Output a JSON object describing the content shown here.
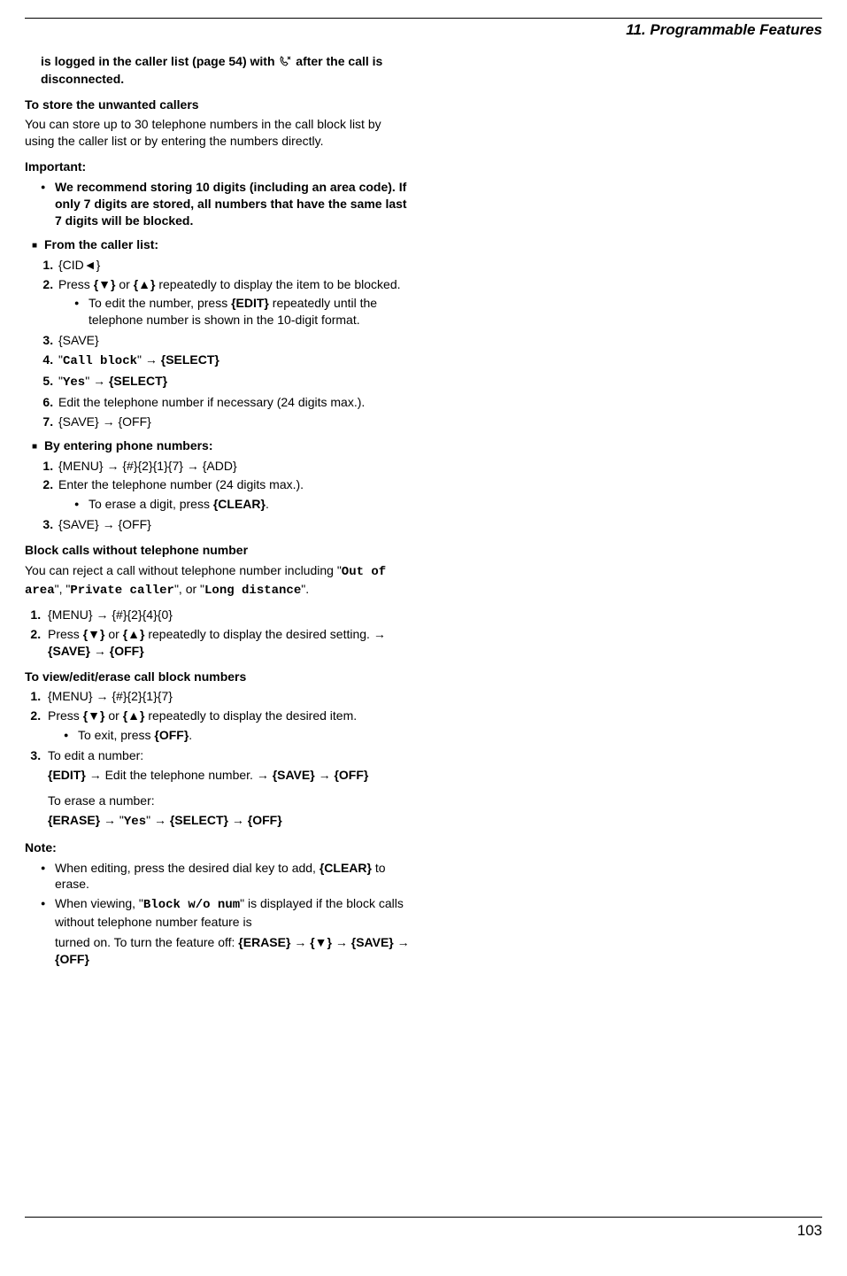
{
  "chapter": "11. Programmable Features",
  "col1": {
    "intro_logged": "is logged in the caller list (page 54) with ",
    "intro_after": " after the call is disconnected.",
    "store_head": "To store the unwanted callers",
    "store_body": "You can store up to 30 telephone numbers in the call block list by using the caller list or by entering the numbers directly.",
    "important_label": "Important:",
    "important_bullet": "We recommend storing 10 digits (including an area code). If only 7 digits are stored, all numbers that have the same last 7 digits will be blocked.",
    "from_caller_list": "From the caller list:",
    "fc1": "{CID◄}",
    "fc2a": "Press ",
    "fc2b": " or ",
    "fc2c": " repeatedly to display the item to be blocked.",
    "fc2_sub": "To edit the number, press {EDIT} repeatedly until the telephone number is shown in the 10-digit format.",
    "fc3": "{SAVE}",
    "fc4a": "\"",
    "fc4_mono": "Call block",
    "fc4b": "\" → {SELECT}",
    "fc5a": "\"",
    "fc5_mono": "Yes",
    "fc5b": "\" → {SELECT}",
    "fc6": "Edit the telephone number if necessary (24 digits max.).",
    "fc7": "{SAVE} → {OFF}",
    "by_entering": "By entering phone numbers:",
    "be1": "{MENU} → {#}{2}{1}{7} → {ADD}",
    "be2": "Enter the telephone number (24 digits max.).",
    "be2_sub": "To erase a digit, press {CLEAR}.",
    "be3": "{SAVE} → {OFF}",
    "block_no_num_head": "Block calls without telephone number",
    "block_no_num_body1": "You can reject a call without telephone number including \"",
    "block_m1": "Out of area",
    "block_mid1": "\", \"",
    "block_m2": "Private caller",
    "block_mid2": "\", or \"",
    "block_m3": "Long distance",
    "block_end": "\".",
    "bn1": "{MENU} → {#}{2}{4}{0}",
    "bn2a": "Press ",
    "bn2b": " or ",
    "bn2c": " repeatedly to display the desired setting. → {SAVE} → {OFF}",
    "veb_head": "To view/edit/erase call block numbers",
    "ve1": "{MENU} → {#}{2}{1}{7}",
    "ve2a": "Press ",
    "ve2b": " or ",
    "ve2c": " repeatedly to display the desired item.",
    "ve2_sub": "To exit, press {OFF}.",
    "ve3_head": "To edit a number:",
    "ve3_body": "{EDIT} → Edit the telephone number. → {SAVE} → {OFF}",
    "ve3_erase_head": "To erase a number:",
    "ve3_erase_a": "{ERASE} → \"",
    "ve3_erase_mono": "Yes",
    "ve3_erase_b": "\" → {SELECT} → {OFF}",
    "note_label": "Note:",
    "note1": "When editing, press the desired dial key to add, {CLEAR} to erase.",
    "note2a": "When viewing, \"",
    "note2_mono": "Block w/o num",
    "note2b": "\" is displayed if the block calls without telephone number feature is"
  },
  "col2": {
    "line1a": "turned on. To turn the feature off: ",
    "line1b": "{ERASE} → ",
    "line2": " → {SAVE} → {OFF}"
  },
  "page": "103"
}
